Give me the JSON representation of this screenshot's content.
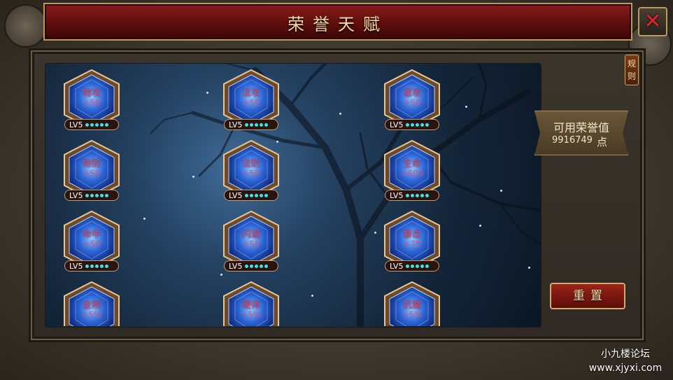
{
  "header": {
    "title": "荣誉天赋"
  },
  "close_button": {
    "icon": "close-icon",
    "glyph": "✕",
    "color": "#e0232a"
  },
  "rules_button": {
    "label": "规则"
  },
  "honor": {
    "label": "可用荣誉值",
    "value": "9916749",
    "unit": "点"
  },
  "reset_button": {
    "label": "重置"
  },
  "talents": [
    {
      "name": "物攻",
      "value": "+50",
      "level": "LV5",
      "pips": 5
    },
    {
      "name": "法攻",
      "value": "+50",
      "level": "LV5",
      "pips": 5
    },
    {
      "name": "道攻",
      "value": "+50",
      "level": "LV5",
      "pips": 5
    },
    {
      "name": "物防",
      "value": "+50",
      "level": "LV5",
      "pips": 5
    },
    {
      "name": "法防",
      "value": "+50",
      "level": "LV5",
      "pips": 5
    },
    {
      "name": "生命",
      "value": "+600",
      "level": "LV5",
      "pips": 5
    },
    {
      "name": "命中",
      "value": "+50",
      "level": "LV5",
      "pips": 5
    },
    {
      "name": "闪避",
      "value": "+50",
      "level": "LV5",
      "pips": 5
    },
    {
      "name": "暴击",
      "value": "+75",
      "level": "LV5",
      "pips": 5
    },
    {
      "name": "金刚",
      "value": "+5%"
    },
    {
      "name": "硬体",
      "value": "+5%"
    },
    {
      "name": "抗魔",
      "value": "+5%"
    }
  ],
  "watermark": {
    "line1": "小九楼论坛",
    "line2": "www.xjyxi.com"
  },
  "colors": {
    "title_bar": "#8a1c1a",
    "gem": "#2d66d8",
    "pip": "#44e0e8",
    "talent_text": "#e0476a"
  }
}
